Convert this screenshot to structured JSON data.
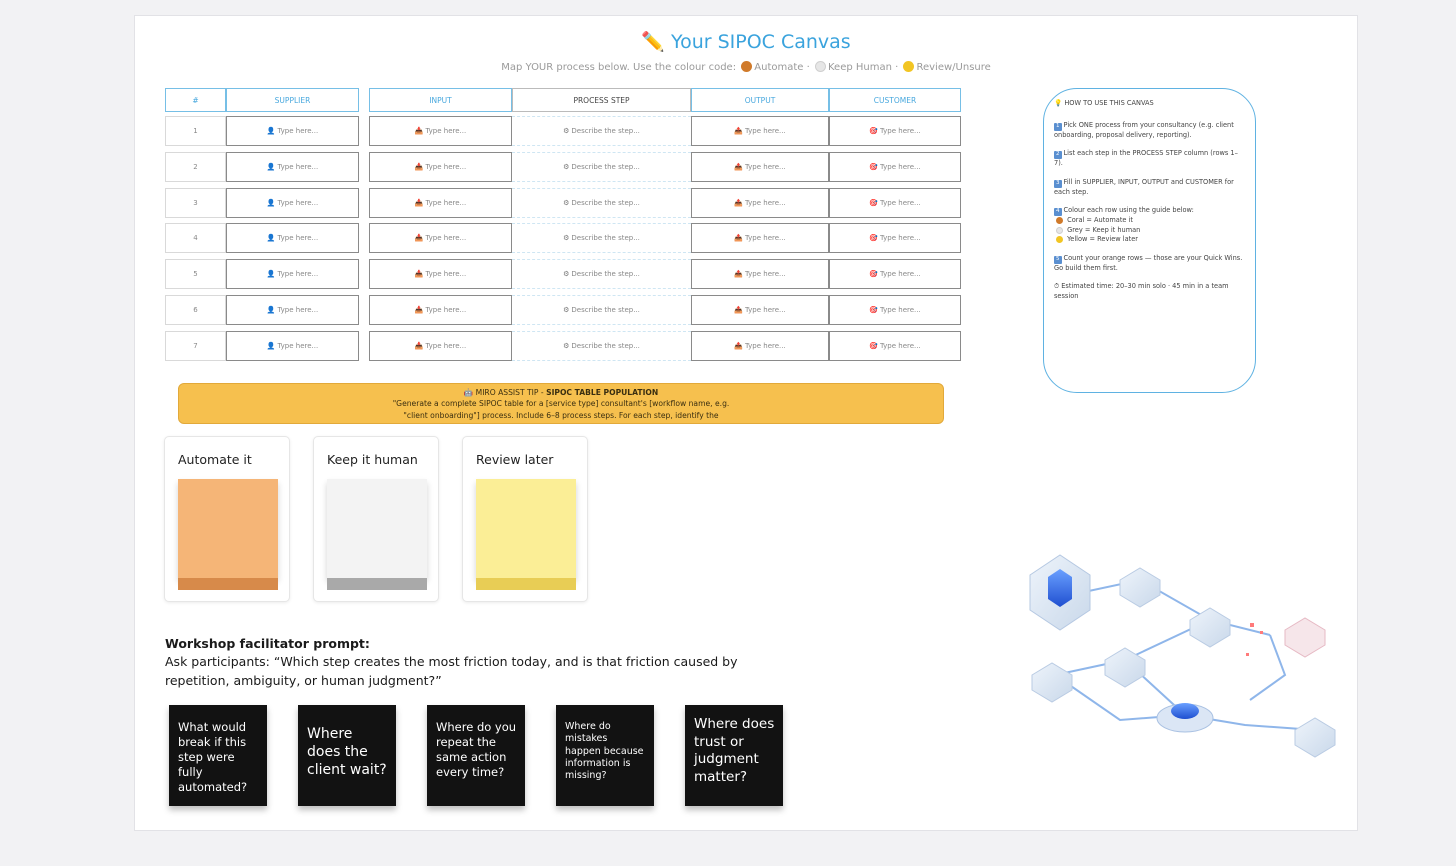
{
  "header": {
    "title_icon": "✏️",
    "title": "Your SIPOC Canvas",
    "subtitle_prefix": "Map YOUR process below. Use the colour code:",
    "legend_automate": "Automate ·",
    "legend_human": "Keep Human ·",
    "legend_review": "Review/Unsure"
  },
  "table": {
    "headers": [
      "#",
      "SUPPLIER",
      "INPUT",
      "PROCESS STEP",
      "OUTPUT",
      "CUSTOMER"
    ],
    "supplier_placeholder": "Type here...",
    "input_placeholder": "Type here...",
    "process_placeholder": "Describe the step...",
    "output_placeholder": "Type here...",
    "customer_placeholder": "Type here...",
    "row_numbers": [
      "1",
      "2",
      "3",
      "4",
      "5",
      "6",
      "7"
    ]
  },
  "howto": {
    "heading": "HOW TO USE THIS CANVAS",
    "step1": "Pick ONE process from your consultancy (e.g. client onboarding, proposal delivery, reporting).",
    "step2": "List each step in the PROCESS STEP column (rows 1–7).",
    "step3": "Fill in SUPPLIER, INPUT, OUTPUT and CUSTOMER for each step.",
    "step4": "Colour each row using the guide below:",
    "coral": "Coral = Automate it",
    "grey": "Grey = Keep it human",
    "yellow": "Yellow = Review later",
    "step5": "Count your orange rows — those are your Quick Wins. Go build them first.",
    "time": "⏱ Estimated time: 20–30 min solo · 45 min in a team session"
  },
  "tip": {
    "prefix": "MIRO ASSIST TIP -",
    "label": "SIPOC TABLE POPULATION",
    "line1": "\"Generate a complete SIPOC table for a [service type] consultant's [workflow name, e.g.",
    "line2": "\"client onboarding\"] process. Include 6–8 process steps. For each step, identify the"
  },
  "legend_cards": {
    "automate": "Automate it",
    "human": "Keep it human",
    "review": "Review later"
  },
  "colors": {
    "automate_face": "#f5b577",
    "automate_base": "#d78a4a",
    "human_face": "#f3f3f3",
    "human_base": "#a9a9a9",
    "review_face": "#fbee96",
    "review_base": "#e8cd55",
    "accent": "#3aa3dd"
  },
  "workshop": {
    "heading": "Workshop facilitator prompt:",
    "body": "Ask participants: “Which step creates the most friction today, and is that friction caused by repetition, ambiguity, or human judgment?”"
  },
  "questions": [
    "What would break if this step were fully automated?",
    "Where does the client wait?",
    "Where do you repeat the same action every time?",
    "Where do mistakes happen because information is missing?",
    "Where does trust or judgment matter?"
  ]
}
